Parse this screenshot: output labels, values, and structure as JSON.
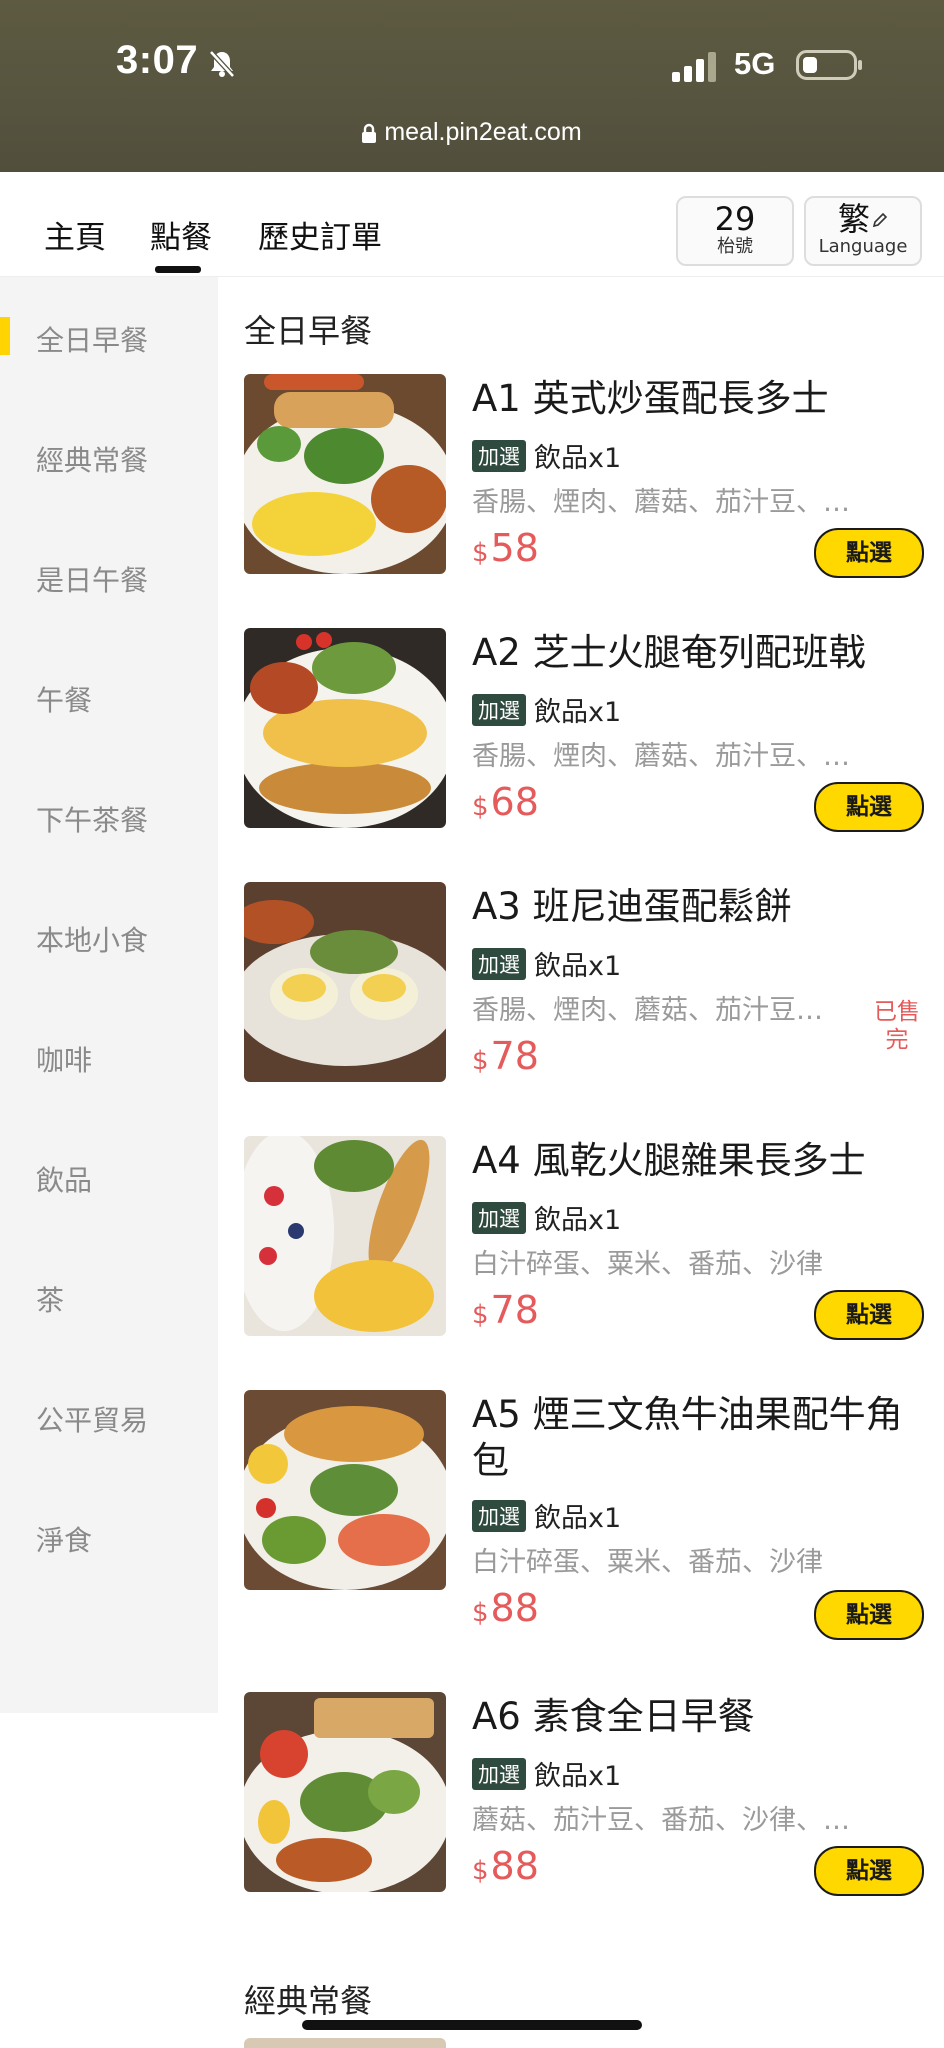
{
  "status_bar": {
    "time": "3:07",
    "network": "5G",
    "url": "meal.pin2eat.com",
    "icons": [
      "bell-slash-icon",
      "signal-icon",
      "battery-icon",
      "lock-icon"
    ]
  },
  "header": {
    "tabs": [
      {
        "label": "主頁"
      },
      {
        "label": "點餐",
        "active": true
      },
      {
        "label": "歷史訂單"
      }
    ],
    "table_number": "29",
    "table_label": "枱號",
    "language_char": "繁",
    "language_label": "Language"
  },
  "sidebar": {
    "active_index": 0,
    "categories": [
      "全日早餐",
      "經典常餐",
      "是日午餐",
      "午餐",
      "下午茶餐",
      "本地小食",
      "咖啡",
      "飲品",
      "茶",
      "公平貿易",
      "淨食"
    ]
  },
  "content": {
    "sections": [
      {
        "title": "全日早餐",
        "items": [
          {
            "code": "A1",
            "name": "A1 英式炒蛋配長多士",
            "opt_badge": "加選",
            "opt_text": "飲品x1",
            "desc": "香腸、煙肉、蘑菇、茄汁豆、…",
            "currency": "$",
            "price": "58",
            "button": "點選",
            "sold_out": false
          },
          {
            "code": "A2",
            "name": "A2 芝士火腿奄列配班戟",
            "opt_badge": "加選",
            "opt_text": "飲品x1",
            "desc": "香腸、煙肉、蘑菇、茄汁豆、…",
            "currency": "$",
            "price": "68",
            "button": "點選",
            "sold_out": false
          },
          {
            "code": "A3",
            "name": "A3 班尼迪蛋配鬆餅",
            "opt_badge": "加選",
            "opt_text": "飲品x1",
            "desc": "香腸、煙肉、蘑菇、茄汁豆…",
            "currency": "$",
            "price": "78",
            "sold_out": true,
            "sold_out_line1": "已售",
            "sold_out_line2": "完"
          },
          {
            "code": "A4",
            "name": "A4 風乾火腿雜果長多士",
            "opt_badge": "加選",
            "opt_text": "飲品x1",
            "desc": "白汁碎蛋、粟米、番茄、沙律",
            "currency": "$",
            "price": "78",
            "button": "點選",
            "sold_out": false
          },
          {
            "code": "A5",
            "name": "A5 煙三文魚牛油果配牛角包",
            "opt_badge": "加選",
            "opt_text": "飲品x1",
            "desc": "白汁碎蛋、粟米、番茄、沙律",
            "currency": "$",
            "price": "88",
            "button": "點選",
            "sold_out": false
          },
          {
            "code": "A6",
            "name": "A6 素食全日早餐",
            "opt_badge": "加選",
            "opt_text": "飲品x1",
            "desc": "蘑菇、茄汁豆、番茄、沙律、…",
            "currency": "$",
            "price": "88",
            "button": "點選",
            "sold_out": false
          }
        ]
      },
      {
        "title": "經典常餐",
        "items": []
      }
    ]
  },
  "colors": {
    "accent_yellow": "#ffd800",
    "price_red": "#e55a5a",
    "badge_green": "#2f4a3f",
    "status_bar_bg": "#57553f"
  }
}
